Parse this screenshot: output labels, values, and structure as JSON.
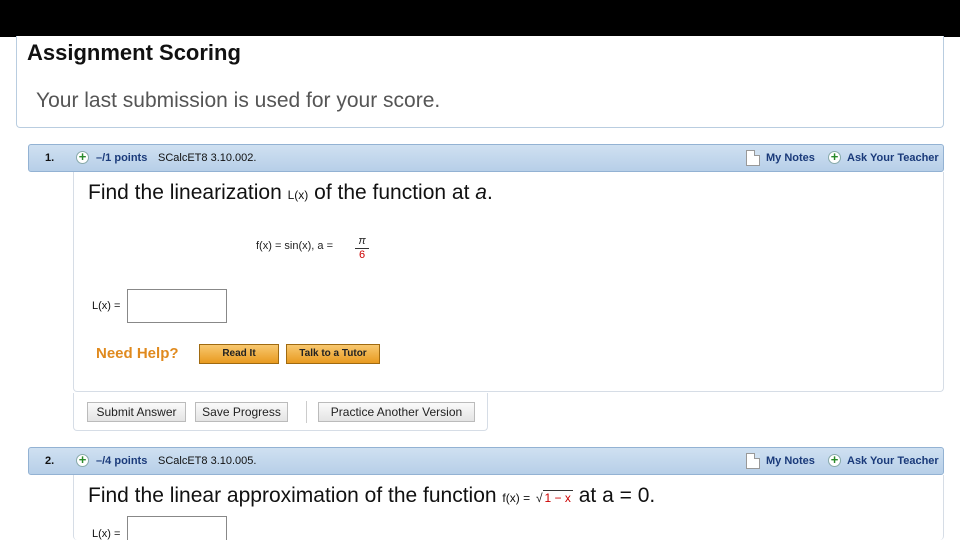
{
  "scoring": {
    "title": "Assignment Scoring",
    "subtitle": "Your last submission is used for your score."
  },
  "questions": [
    {
      "number": "1.",
      "points": "–/1 points",
      "source": "SCalcET8 3.10.002.",
      "my_notes": "My Notes",
      "ask_teacher": "Ask Your Teacher",
      "prompt_start": "Find the linearization",
      "prompt_func": "L(x)",
      "prompt_end": "of the function at",
      "prompt_var": "a",
      "prompt_dot": ".",
      "function_text": "f(x) = sin(x),   a =",
      "a_numerator": "π",
      "a_denominator": "6",
      "answer_label": "L(x) =",
      "answer_value": "",
      "need_help": "Need Help?",
      "read_it": "Read It",
      "talk_tutor": "Talk to a Tutor"
    },
    {
      "number": "2.",
      "points": "–/4 points",
      "source": "SCalcET8 3.10.005.",
      "my_notes": "My Notes",
      "ask_teacher": "Ask Your Teacher",
      "prompt_start": "Find the linear approximation of the function",
      "prompt_func": "f(x) =",
      "prompt_radicand": "1 − x",
      "prompt_end": "at a = 0.",
      "answer_label": "L(x) =",
      "answer_value": ""
    }
  ],
  "actions": {
    "submit": "Submit Answer",
    "save": "Save Progress",
    "practice": "Practice Another Version"
  }
}
